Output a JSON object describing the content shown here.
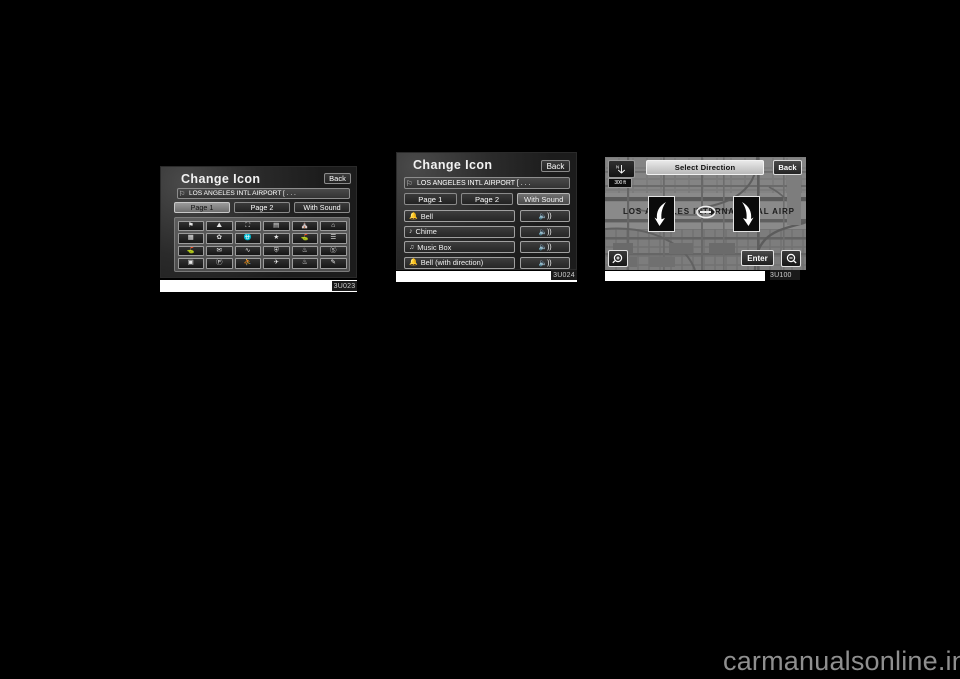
{
  "page": {
    "background_color": "#000000",
    "watermark": "carmanualsonline.info"
  },
  "figures": [
    {
      "id": "figure-change-icon-grid",
      "caption": "3U023",
      "screen": {
        "title": "Change Icon",
        "back_label": "Back",
        "location_field": {
          "icon": "flag-icon",
          "value": "LOS ANGELES INTL AIRPORT [ . . .",
          "placeholder": "LOS ANGELES INTL AIRPORT [ . . ."
        },
        "tabs": [
          {
            "label": "Page 1",
            "selected": true
          },
          {
            "label": "Page 2",
            "selected": false
          },
          {
            "label": "With Sound",
            "selected": false
          }
        ],
        "icon_grid": {
          "columns": 6,
          "rows": 4,
          "icons": [
            "checkered-flag-icon",
            "restaurant-icon",
            "shopping-bag-icon",
            "building-icon",
            "hotel-icon",
            "home-icon",
            "bank-icon",
            "leaf-icon",
            "ball-icon",
            "fork-knife-icon",
            "fuel-icon",
            "parking-lot-icon",
            "golf-icon",
            "gift-icon",
            "pool-icon",
            "briefcase-icon",
            "tree-icon",
            "clock-icon",
            "book-icon",
            "parking-icon",
            "people-icon",
            "airplane-icon",
            "fountain-icon",
            "pencil-icon"
          ]
        }
      }
    },
    {
      "id": "figure-change-icon-sound",
      "caption": "3U024",
      "screen": {
        "title": "Change Icon",
        "back_label": "Back",
        "location_field": {
          "icon": "flag-icon",
          "value": "LOS ANGELES INTL AIRPORT [ . . .",
          "placeholder": "LOS ANGELES INTL AIRPORT [ . . ."
        },
        "tabs": [
          {
            "label": "Page 1",
            "selected": false
          },
          {
            "label": "Page 2",
            "selected": false
          },
          {
            "label": "With Sound",
            "selected": true
          }
        ],
        "sound_rows": [
          {
            "icon": "bell-icon",
            "label": "Bell",
            "play_icon": "speaker-icon"
          },
          {
            "icon": "chime-icon",
            "label": "Chime",
            "play_icon": "speaker-icon"
          },
          {
            "icon": "music-box-icon",
            "label": "Music Box",
            "play_icon": "speaker-icon"
          },
          {
            "icon": "bell-direction-icon",
            "label": "Bell (with direction)",
            "play_icon": "speaker-icon"
          }
        ]
      }
    },
    {
      "id": "figure-select-direction",
      "caption": "3U100",
      "screen": {
        "title": "Select Direction",
        "back_label": "Back",
        "enter_label": "Enter",
        "map_scale_label": "300 ft",
        "compass_icon": "north-up-compass-icon",
        "zoom_in_icon": "magnifier-plus-icon",
        "zoom_out_icon": "magnifier-minus-icon",
        "map_text": "LOS ANGELES INTERNATIONAL AIRP",
        "direction_buttons": [
          {
            "icon": "curved-arrow-left-icon",
            "name": "direction-left"
          },
          {
            "icon": "curved-arrow-right-icon",
            "name": "direction-right"
          }
        ]
      }
    }
  ]
}
